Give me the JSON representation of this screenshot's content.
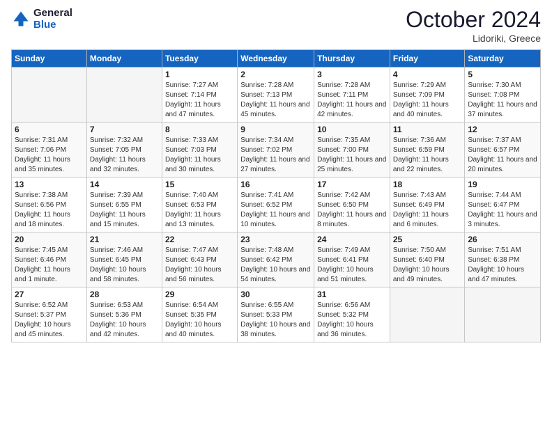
{
  "header": {
    "logo_general": "General",
    "logo_blue": "Blue",
    "month_title": "October 2024",
    "location": "Lidoriki, Greece"
  },
  "weekdays": [
    "Sunday",
    "Monday",
    "Tuesday",
    "Wednesday",
    "Thursday",
    "Friday",
    "Saturday"
  ],
  "weeks": [
    [
      {
        "day": "",
        "info": ""
      },
      {
        "day": "",
        "info": ""
      },
      {
        "day": "1",
        "info": "Sunrise: 7:27 AM\nSunset: 7:14 PM\nDaylight: 11 hours and 47 minutes."
      },
      {
        "day": "2",
        "info": "Sunrise: 7:28 AM\nSunset: 7:13 PM\nDaylight: 11 hours and 45 minutes."
      },
      {
        "day": "3",
        "info": "Sunrise: 7:28 AM\nSunset: 7:11 PM\nDaylight: 11 hours and 42 minutes."
      },
      {
        "day": "4",
        "info": "Sunrise: 7:29 AM\nSunset: 7:09 PM\nDaylight: 11 hours and 40 minutes."
      },
      {
        "day": "5",
        "info": "Sunrise: 7:30 AM\nSunset: 7:08 PM\nDaylight: 11 hours and 37 minutes."
      }
    ],
    [
      {
        "day": "6",
        "info": "Sunrise: 7:31 AM\nSunset: 7:06 PM\nDaylight: 11 hours and 35 minutes."
      },
      {
        "day": "7",
        "info": "Sunrise: 7:32 AM\nSunset: 7:05 PM\nDaylight: 11 hours and 32 minutes."
      },
      {
        "day": "8",
        "info": "Sunrise: 7:33 AM\nSunset: 7:03 PM\nDaylight: 11 hours and 30 minutes."
      },
      {
        "day": "9",
        "info": "Sunrise: 7:34 AM\nSunset: 7:02 PM\nDaylight: 11 hours and 27 minutes."
      },
      {
        "day": "10",
        "info": "Sunrise: 7:35 AM\nSunset: 7:00 PM\nDaylight: 11 hours and 25 minutes."
      },
      {
        "day": "11",
        "info": "Sunrise: 7:36 AM\nSunset: 6:59 PM\nDaylight: 11 hours and 22 minutes."
      },
      {
        "day": "12",
        "info": "Sunrise: 7:37 AM\nSunset: 6:57 PM\nDaylight: 11 hours and 20 minutes."
      }
    ],
    [
      {
        "day": "13",
        "info": "Sunrise: 7:38 AM\nSunset: 6:56 PM\nDaylight: 11 hours and 18 minutes."
      },
      {
        "day": "14",
        "info": "Sunrise: 7:39 AM\nSunset: 6:55 PM\nDaylight: 11 hours and 15 minutes."
      },
      {
        "day": "15",
        "info": "Sunrise: 7:40 AM\nSunset: 6:53 PM\nDaylight: 11 hours and 13 minutes."
      },
      {
        "day": "16",
        "info": "Sunrise: 7:41 AM\nSunset: 6:52 PM\nDaylight: 11 hours and 10 minutes."
      },
      {
        "day": "17",
        "info": "Sunrise: 7:42 AM\nSunset: 6:50 PM\nDaylight: 11 hours and 8 minutes."
      },
      {
        "day": "18",
        "info": "Sunrise: 7:43 AM\nSunset: 6:49 PM\nDaylight: 11 hours and 6 minutes."
      },
      {
        "day": "19",
        "info": "Sunrise: 7:44 AM\nSunset: 6:47 PM\nDaylight: 11 hours and 3 minutes."
      }
    ],
    [
      {
        "day": "20",
        "info": "Sunrise: 7:45 AM\nSunset: 6:46 PM\nDaylight: 11 hours and 1 minute."
      },
      {
        "day": "21",
        "info": "Sunrise: 7:46 AM\nSunset: 6:45 PM\nDaylight: 10 hours and 58 minutes."
      },
      {
        "day": "22",
        "info": "Sunrise: 7:47 AM\nSunset: 6:43 PM\nDaylight: 10 hours and 56 minutes."
      },
      {
        "day": "23",
        "info": "Sunrise: 7:48 AM\nSunset: 6:42 PM\nDaylight: 10 hours and 54 minutes."
      },
      {
        "day": "24",
        "info": "Sunrise: 7:49 AM\nSunset: 6:41 PM\nDaylight: 10 hours and 51 minutes."
      },
      {
        "day": "25",
        "info": "Sunrise: 7:50 AM\nSunset: 6:40 PM\nDaylight: 10 hours and 49 minutes."
      },
      {
        "day": "26",
        "info": "Sunrise: 7:51 AM\nSunset: 6:38 PM\nDaylight: 10 hours and 47 minutes."
      }
    ],
    [
      {
        "day": "27",
        "info": "Sunrise: 6:52 AM\nSunset: 5:37 PM\nDaylight: 10 hours and 45 minutes."
      },
      {
        "day": "28",
        "info": "Sunrise: 6:53 AM\nSunset: 5:36 PM\nDaylight: 10 hours and 42 minutes."
      },
      {
        "day": "29",
        "info": "Sunrise: 6:54 AM\nSunset: 5:35 PM\nDaylight: 10 hours and 40 minutes."
      },
      {
        "day": "30",
        "info": "Sunrise: 6:55 AM\nSunset: 5:33 PM\nDaylight: 10 hours and 38 minutes."
      },
      {
        "day": "31",
        "info": "Sunrise: 6:56 AM\nSunset: 5:32 PM\nDaylight: 10 hours and 36 minutes."
      },
      {
        "day": "",
        "info": ""
      },
      {
        "day": "",
        "info": ""
      }
    ]
  ]
}
